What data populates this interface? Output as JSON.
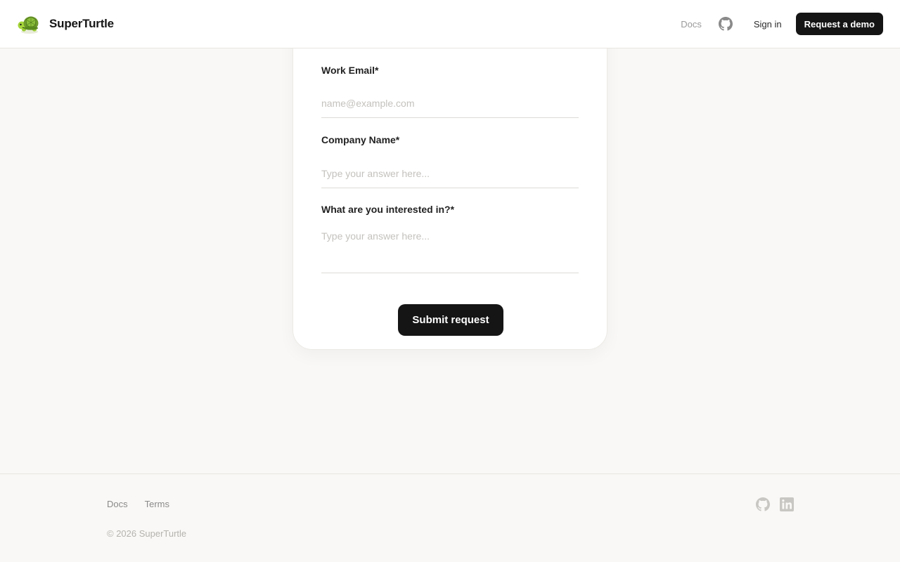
{
  "header": {
    "brand_name": "SuperTurtle",
    "logo_icon": "turtle-logo-icon",
    "nav": {
      "docs_label": "Docs",
      "github_icon": "github-icon",
      "signin_label": "Sign in",
      "demo_label": "Request a demo"
    }
  },
  "form": {
    "fields": [
      {
        "label": "Work Email*",
        "value": "",
        "placeholder": "name@example.com"
      },
      {
        "label": "Company Name*",
        "value": "",
        "placeholder": "Type your answer here..."
      },
      {
        "label": "What are you interested in?*",
        "value": "",
        "placeholder": "Type your answer here..."
      }
    ],
    "submit_label": "Submit request"
  },
  "footer": {
    "links": [
      "Docs",
      "Terms"
    ],
    "copyright": "© 2026 SuperTurtle",
    "social_icons": [
      "github-icon",
      "linkedin-icon"
    ]
  },
  "colors": {
    "page_background": "#f9f8f6",
    "primary_button": "#151515",
    "card_background": "#ffffff"
  }
}
